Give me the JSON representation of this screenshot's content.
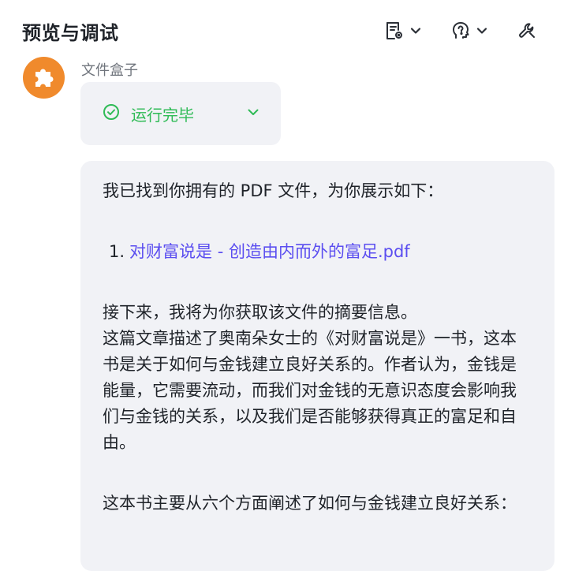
{
  "header": {
    "title": "预览与调试"
  },
  "toolbar": {
    "items": [
      {
        "icon": "document-settings-icon",
        "has_dropdown": true
      },
      {
        "icon": "voice-head-icon",
        "has_dropdown": true
      },
      {
        "icon": "wrench-icon",
        "has_dropdown": false
      }
    ]
  },
  "message": {
    "sender": "文件盒子",
    "avatar_icon": "puzzle-piece-icon",
    "status": {
      "icon": "check-circle-icon",
      "label": "运行完毕",
      "color": "#2fbb56"
    },
    "intro": "我已找到你拥有的 PDF 文件，为你展示如下：",
    "files": [
      {
        "index": "1.",
        "name": "对财富说是 - 创造由内而外的富足.pdf"
      }
    ],
    "para1_line1": "接下来，我将为你获取该文件的摘要信息。",
    "para1_line2": "这篇文章描述了奥南朵女士的《对财富说是》一书，这本书是关于如何与金钱建立良好关系的。作者认为，金钱是能量，它需要流动，而我们对金钱的无意识态度会影响我们与金钱的关系，以及我们是否能够获得真正的富足和自由。",
    "para2": "这本书主要从六个方面阐述了如何与金钱建立良好关系："
  },
  "colors": {
    "accent_link": "#5b4ef0",
    "card_bg": "#f1f2f6",
    "avatar_bg": "#f08a2c"
  }
}
